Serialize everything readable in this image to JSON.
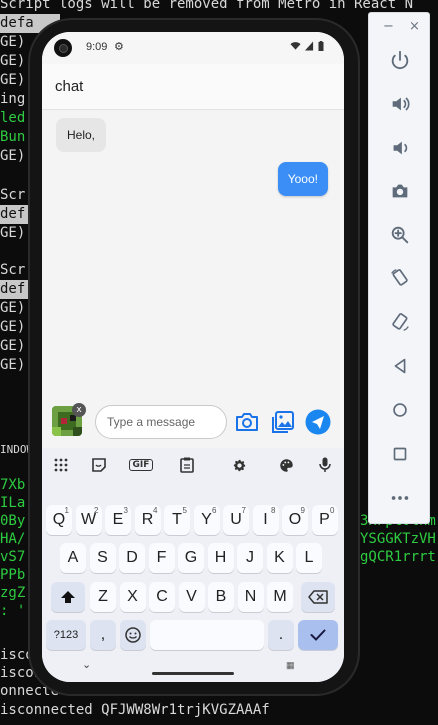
{
  "terminal": {
    "lines": [
      {
        "text": "Script logs will be removed from Metro in React N",
        "style": ""
      },
      {
        "text": "defa",
        "style": "hl",
        "tail": "al"
      },
      {
        "text": "GE)",
        "style": ""
      },
      {
        "text": "GE)",
        "style": ""
      },
      {
        "text": "GE)",
        "style": ""
      },
      {
        "text": "ing",
        "style": ""
      },
      {
        "text": "led",
        "style": "green"
      },
      {
        "text": "Bun",
        "style": "green"
      },
      {
        "text": "GE)",
        "style": ""
      },
      {
        "text": "Scr",
        "style": ""
      },
      {
        "text": "def",
        "style": "hl"
      },
      {
        "text": "GE)",
        "style": ""
      },
      {
        "text": "Scr",
        "style": ""
      },
      {
        "text": "def",
        "style": "hl"
      },
      {
        "text": "GE)",
        "style": ""
      },
      {
        "text": "GE)",
        "style": ""
      },
      {
        "text": "GE)",
        "style": ""
      },
      {
        "text": "GE)",
        "style": ""
      },
      {
        "text": "INDOW",
        "style": ""
      },
      {
        "text": "7Xb",
        "style": "green"
      },
      {
        "text": "ILa",
        "style": "green"
      },
      {
        "text": "0By",
        "style": "green"
      },
      {
        "text": "HA/",
        "style": "green"
      },
      {
        "text": "vS7",
        "style": "green"
      },
      {
        "text": "PPb",
        "style": "green"
      },
      {
        "text": "zgZ",
        "style": "green"
      },
      {
        "text": ": '",
        "style": "green"
      },
      {
        "text": "isconne",
        "style": ""
      },
      {
        "text": "iscon",
        "style": ""
      },
      {
        "text": "onnecte",
        "style": ""
      },
      {
        "text": "isconnected QFJWW8Wr1trjKVGZAAAf",
        "style": ""
      }
    ],
    "right_fragments": [
      "ly",
      "v",
      "3xFpt0lnm",
      "YSGGKTzVH",
      "gQCR1rrrt"
    ]
  },
  "emulator": {
    "minimize_label": "−",
    "close_label": "×",
    "buttons": [
      "power-icon",
      "volume-up-icon",
      "volume-down-icon",
      "camera-icon",
      "zoom-icon",
      "rotate-left-icon",
      "rotate-right-icon",
      "back-icon",
      "home-icon",
      "overview-icon",
      "more-icon"
    ]
  },
  "phone": {
    "status": {
      "time": "9:09"
    },
    "header": {
      "title": "chat"
    },
    "messages": [
      {
        "from": "other",
        "text": "Helo,"
      },
      {
        "from": "me",
        "text": "Yooo!"
      }
    ],
    "composer": {
      "placeholder": "Type a message",
      "avatar_close": "x"
    },
    "keyboard": {
      "tools": [
        "grid-icon",
        "sticker-icon",
        "GIF",
        "clipboard-icon",
        "settings-icon",
        "palette-icon",
        "mic-icon"
      ],
      "row1": [
        {
          "k": "Q",
          "h": "1"
        },
        {
          "k": "W",
          "h": "2"
        },
        {
          "k": "E",
          "h": "3"
        },
        {
          "k": "R",
          "h": "4"
        },
        {
          "k": "T",
          "h": "5"
        },
        {
          "k": "Y",
          "h": "6"
        },
        {
          "k": "U",
          "h": "7"
        },
        {
          "k": "I",
          "h": "8"
        },
        {
          "k": "O",
          "h": "9"
        },
        {
          "k": "P",
          "h": "0"
        }
      ],
      "row2": [
        "A",
        "S",
        "D",
        "F",
        "G",
        "H",
        "J",
        "K",
        "L"
      ],
      "row3": [
        "Z",
        "X",
        "C",
        "V",
        "B",
        "N",
        "M"
      ],
      "symbols_label": "?123",
      "comma_label": ",",
      "period_label": ".",
      "gif_label": "GIF"
    },
    "colors": {
      "bubble_out": "#3a8ef5",
      "accent": "#1a73e8",
      "send": "#1a86f0"
    }
  }
}
